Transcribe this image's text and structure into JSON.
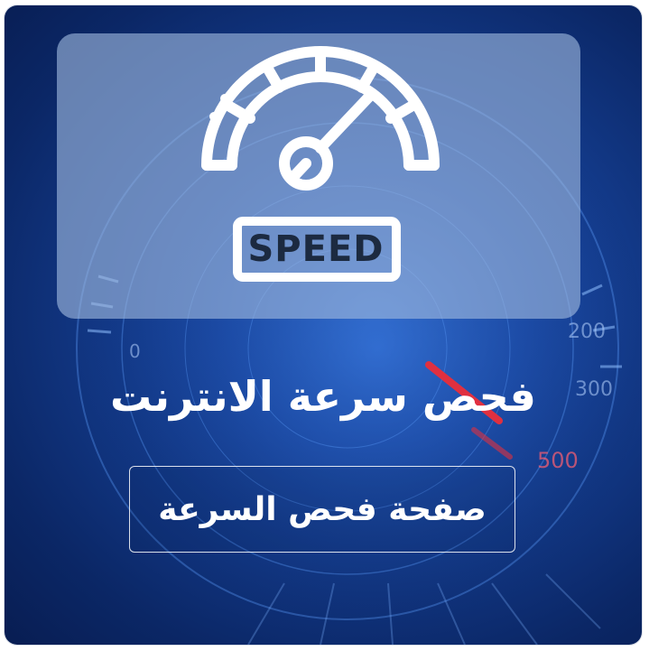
{
  "hero": {
    "icon": "speedometer-icon",
    "badge_text": "SPEED"
  },
  "background": {
    "gauge_ticks": [
      "0",
      "200",
      "300",
      "500"
    ],
    "accent_color": "#e03040"
  },
  "title": "فحص سرعة الانترنت",
  "cta": {
    "label": "صفحة فحص السرعة"
  }
}
